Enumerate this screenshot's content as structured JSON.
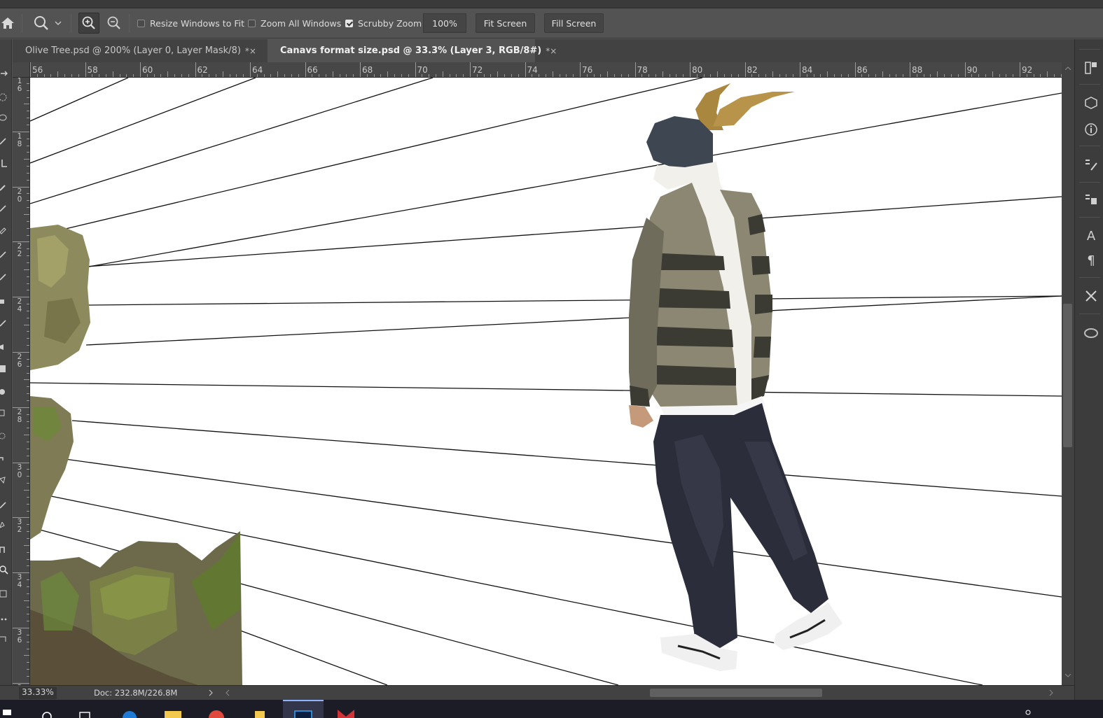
{
  "options_bar": {
    "resize_windows": {
      "label": "Resize Windows to Fit",
      "checked": false
    },
    "zoom_all": {
      "label": "Zoom All Windows",
      "checked": false
    },
    "scrubby_zoom": {
      "label": "Scrubby Zoom",
      "checked": true
    },
    "zoom_value": "100%",
    "fit_screen": "Fit Screen",
    "fill_screen": "Fill Screen"
  },
  "tabs": [
    {
      "label": "Olive Tree.psd @ 200% (Layer 0, Layer Mask/8)",
      "close": "*×",
      "active": false
    },
    {
      "label": "Canavs format size.psd @ 33.3% (Layer 3, RGB/8#)",
      "close": "*×",
      "active": true
    }
  ],
  "ruler_h": [
    "56",
    "58",
    "60",
    "62",
    "64",
    "66",
    "68",
    "70",
    "72",
    "74",
    "76",
    "78",
    "80",
    "82",
    "84",
    "86",
    "88",
    "90",
    "92"
  ],
  "ruler_v": [
    "16",
    "18",
    "20",
    "22",
    "24",
    "26",
    "28",
    "30",
    "32",
    "34",
    "36",
    "3"
  ],
  "status": {
    "zoom": "33.33%",
    "doc": "Doc: 232.8M/226.8M"
  },
  "colors": {
    "panel": "#535353",
    "dark_panel": "#424242",
    "canvas": "#ffffff",
    "taskbar": "#1b1c26",
    "horn": "#b08d4a",
    "sweater_dark": "#3b3a33",
    "sweater_light": "#8b8772",
    "pants": "#2c2d3b"
  },
  "icons": {
    "home": "home-icon",
    "zoom_tool": "zoom-tool-icon",
    "zoom_in": "zoom-in-icon",
    "zoom_out": "zoom-out-icon"
  }
}
